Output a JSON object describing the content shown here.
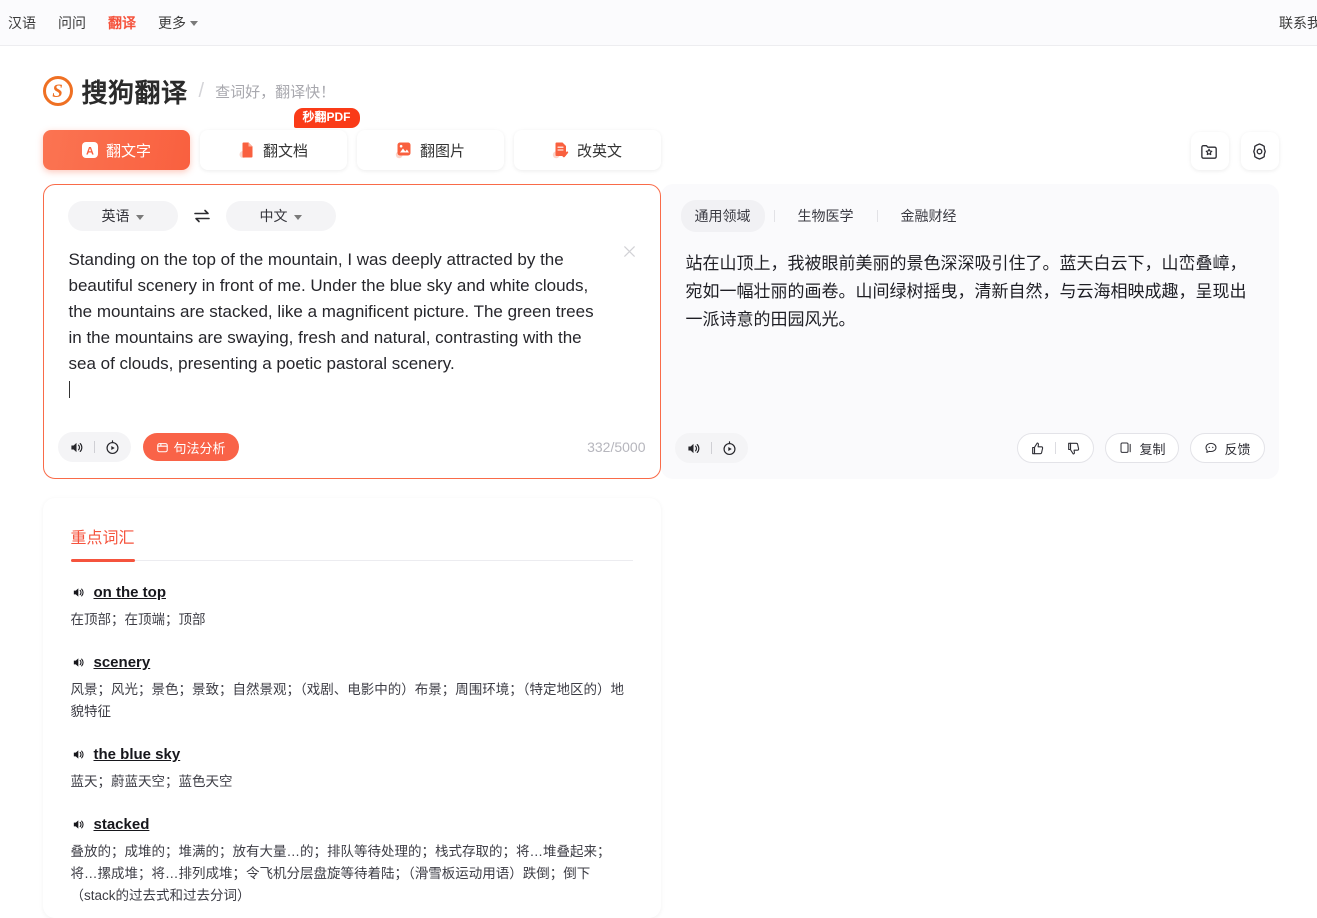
{
  "topnav": {
    "items": [
      {
        "label": "汉语",
        "active": false
      },
      {
        "label": "问问",
        "active": false
      },
      {
        "label": "翻译",
        "active": true
      },
      {
        "label": "更多",
        "active": false
      }
    ],
    "right_label": "联系我们"
  },
  "brand": {
    "logo_letter": "S",
    "name": "搜狗翻译",
    "separator": "/",
    "slogan": "查词好，翻译快！"
  },
  "tabs": [
    {
      "label": "翻文字",
      "icon": "text-translate-icon",
      "active": true
    },
    {
      "label": "翻文档",
      "icon": "document-translate-icon",
      "active": false
    },
    {
      "label": "翻图片",
      "icon": "image-translate-icon",
      "active": false
    },
    {
      "label": "改英文",
      "icon": "english-polish-icon",
      "active": false
    }
  ],
  "badge": {
    "label": "秒翻PDF"
  },
  "header_icons": [
    {
      "name": "favorites-icon"
    },
    {
      "name": "settings-gear-icon"
    }
  ],
  "source": {
    "lang_from": "英语",
    "lang_to": "中文",
    "swap_icon": "swap-arrows-icon",
    "text": "Standing on the top of the mountain, I was deeply attracted by the beautiful scenery in front of me. Under the blue sky and white clouds, the mountains are stacked, like a magnificent picture. The green trees in the mountains are swaying, fresh and natural, contrasting with the sea of clouds, presenting a poetic pastoral scenery.",
    "clear_icon": "clear-x-icon",
    "speaker_icon": "speaker-icon",
    "slow_play_icon": "slow-play-icon",
    "syntax_button": "句法分析",
    "char_count": "332/5000"
  },
  "target": {
    "domains": [
      {
        "label": "通用领域",
        "active": true
      },
      {
        "label": "生物医学",
        "active": false
      },
      {
        "label": "金融财经",
        "active": false
      }
    ],
    "text": "站在山顶上，我被眼前美丽的景色深深吸引住了。蓝天白云下，山峦叠嶂，宛如一幅壮丽的画卷。山间绿树摇曳，清新自然，与云海相映成趣，呈现出一派诗意的田园风光。",
    "speaker_icon": "speaker-icon",
    "slow_play_icon": "slow-play-icon",
    "thumbs_up_icon": "thumbs-up-icon",
    "thumbs_down_icon": "thumbs-down-icon",
    "copy_label": "复制",
    "feedback_label": "反馈"
  },
  "vocab": {
    "title": "重点词汇",
    "entries": [
      {
        "word": "on the top",
        "definition": "在顶部；在顶端；顶部"
      },
      {
        "word": "scenery",
        "definition": "风景；风光；景色；景致；自然景观；（戏剧、电影中的）布景；周围环境；（特定地区的）地貌特征"
      },
      {
        "word": "the blue sky",
        "definition": "蓝天；蔚蓝天空；蓝色天空"
      },
      {
        "word": "stacked",
        "definition": "叠放的；成堆的；堆满的；放有大量…的；排队等待处理的；栈式存取的；将…堆叠起来；将…摞成堆；将…排列成堆；令飞机分层盘旋等待着陆；（滑雪板运动用语）跌倒；倒下（stack的过去式和过去分词）"
      }
    ]
  },
  "colors": {
    "accent": "#f5533d",
    "accent_tab": "#f9603f",
    "badge": "#fa3b18",
    "logo": "#ef7023",
    "panel_bg": "#fafafc"
  }
}
